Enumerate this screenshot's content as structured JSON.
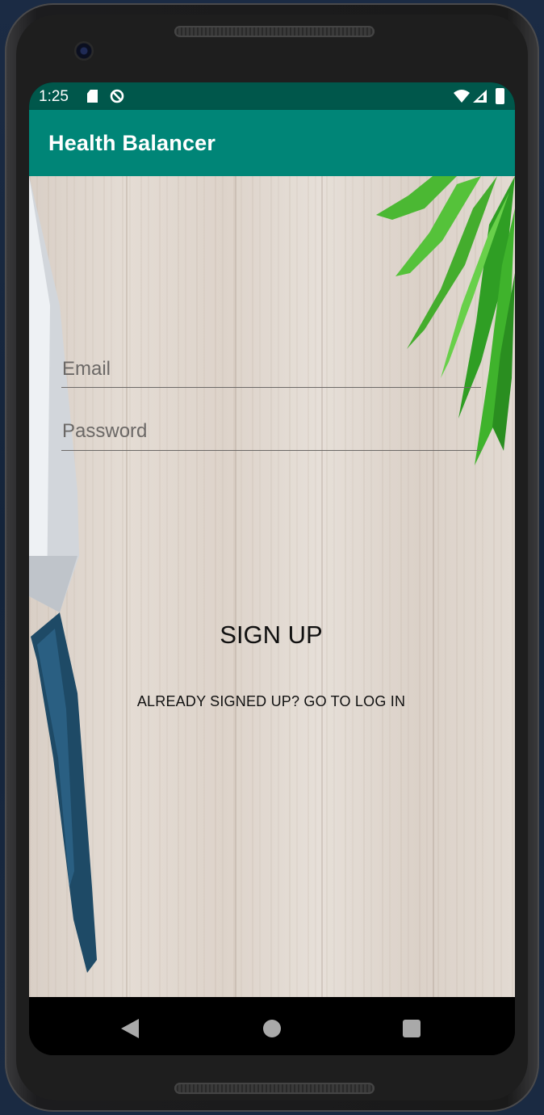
{
  "status_bar": {
    "time": "1:25",
    "icons": [
      "sd-card-icon",
      "blocked-icon",
      "wifi-icon",
      "signal-icon",
      "battery-icon"
    ],
    "background_color": "#00574b"
  },
  "app_bar": {
    "title": "Health Balancer",
    "background_color": "#008577"
  },
  "form": {
    "email": {
      "value": "",
      "placeholder": "Email"
    },
    "password": {
      "value": "",
      "placeholder": "Password"
    },
    "signup_label": "SIGN UP",
    "login_link_label": "ALREADY SIGNED UP? GO TO LOG IN"
  },
  "nav_bar": {
    "buttons": [
      "back-icon",
      "home-icon",
      "recents-icon"
    ]
  }
}
